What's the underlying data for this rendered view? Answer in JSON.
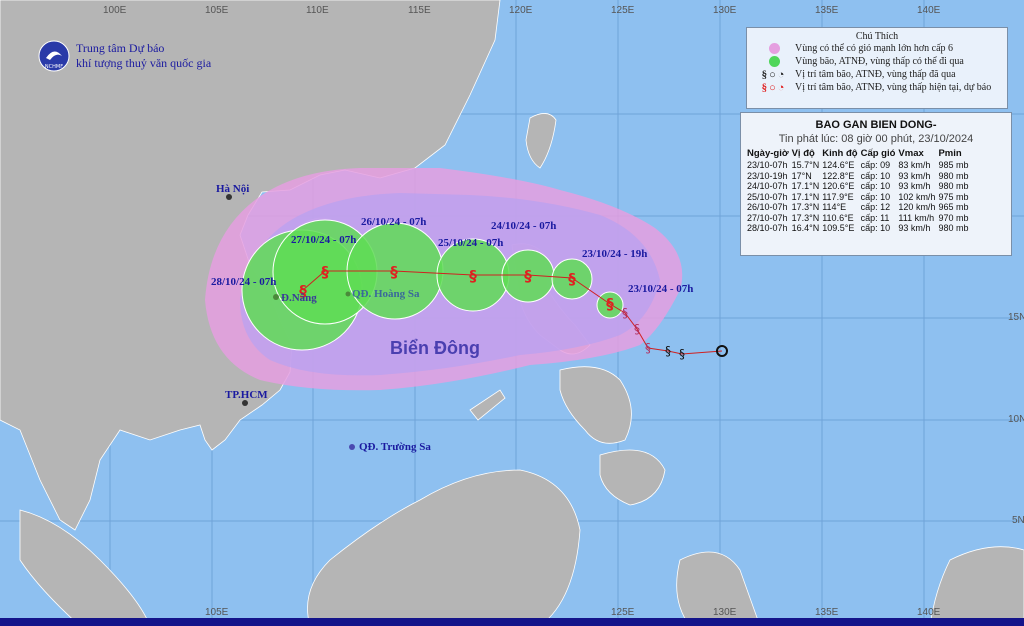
{
  "organization": {
    "line1": "Trung tâm Dự báo",
    "line2": "khí tượng thuỷ văn quốc gia",
    "logo_text": "NCHMF"
  },
  "legend": {
    "title": "Chú Thích",
    "items": [
      {
        "text": "Vùng có thể có gió mạnh lớn hơn cấp 6",
        "color": "#e59fe0"
      },
      {
        "text": "Vùng bão, ATNĐ, vùng thấp có thể đi qua",
        "color": "#4fd65a"
      },
      {
        "text": "Vị trí tâm bão, ATNĐ, vùng thấp đã qua",
        "color": "#222222"
      },
      {
        "text": "Vị trí tâm bão, ATNĐ, vùng thấp hiện tại, dự báo",
        "color": "#e02020"
      }
    ]
  },
  "bulletin": {
    "title": "BAO GAN BIEN DONG-",
    "issued": "Tin phát lúc: 08 giờ 00 phút, 23/10/2024",
    "columns": [
      "Ngày-giờ",
      "Vị độ",
      "Kinh độ",
      "Cấp gió",
      "Vmax",
      "Pmin"
    ],
    "rows": [
      [
        "23/10-07h",
        "15.7°N",
        "124.6°E",
        "cấp: 09",
        "83 km/h",
        "985 mb"
      ],
      [
        "23/10-19h",
        "17°N",
        "122.8°E",
        "cấp: 10",
        "93 km/h",
        "980 mb"
      ],
      [
        "24/10-07h",
        "17.1°N",
        "120.6°E",
        "cấp: 10",
        "93 km/h",
        "980 mb"
      ],
      [
        "25/10-07h",
        "17.1°N",
        "117.9°E",
        "cấp: 10",
        "102 km/h",
        "975 mb"
      ],
      [
        "26/10-07h",
        "17.3°N",
        "114°E",
        "cấp: 12",
        "120 km/h",
        "965 mb"
      ],
      [
        "27/10-07h",
        "17.3°N",
        "110.6°E",
        "cấp: 11",
        "111 km/h",
        "970 mb"
      ],
      [
        "28/10-07h",
        "16.4°N",
        "109.5°E",
        "cấp: 10",
        "93 km/h",
        "980 mb"
      ]
    ]
  },
  "map": {
    "top_longitudes": [
      "100E",
      "105E",
      "110E",
      "115E",
      "120E",
      "125E",
      "130E",
      "135E",
      "140E"
    ],
    "bottom_longitudes": [
      "105E",
      "125E",
      "130E",
      "135E",
      "140E"
    ],
    "right_latitudes": [
      "15N",
      "10N",
      "5N"
    ],
    "sea_name": "Biển Đông",
    "places": {
      "hanoi": "Hà Nội",
      "danang": "Đ.Nẵng",
      "hoangsa": "QĐ. Hoàng Sa",
      "hcm": "TP.HCM",
      "truongsa": "QĐ. Trường Sa"
    },
    "forecast_labels": [
      "27/10/24 - 07h",
      "26/10/24 - 07h",
      "25/10/24 - 07h",
      "24/10/24 - 07h",
      "23/10/24 - 19h",
      "28/10/24 - 07h",
      "23/10/24 - 07h"
    ]
  }
}
